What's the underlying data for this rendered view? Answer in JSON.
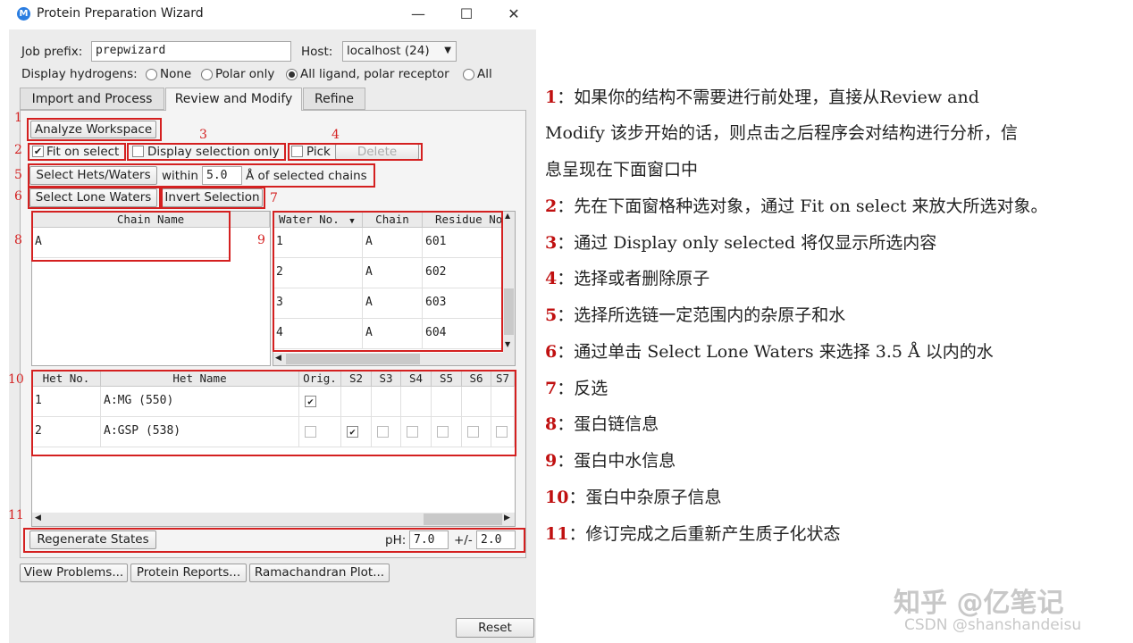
{
  "window": {
    "title": "Protein Preparation Wizard",
    "app_icon_letter": "M",
    "minimize": "—",
    "maximize": "☐",
    "close": "✕"
  },
  "form": {
    "job_prefix_label": "Job prefix:",
    "job_prefix_value": "prepwizard",
    "host_label": "Host:",
    "host_value": "localhost (24)",
    "display_hydrogens_label": "Display hydrogens:",
    "hydrogen_options": [
      "None",
      "Polar only",
      "All ligand, polar receptor",
      "All"
    ],
    "hydrogen_selected": "All ligand, polar receptor"
  },
  "tabs": [
    "Import and Process",
    "Review and Modify",
    "Refine"
  ],
  "active_tab": "Review and Modify",
  "review": {
    "analyze_button": "Analyze Workspace",
    "fit_on_select": "Fit on select",
    "fit_on_select_checked": true,
    "display_selection_only": "Display selection only",
    "pick_label": "Pick",
    "delete_button": "Delete",
    "select_hets_button": "Select Hets/Waters",
    "within_label": "within",
    "within_value": "5.0",
    "of_selected_label": "Å of selected chains",
    "select_lone_waters_button": "Select Lone Waters",
    "invert_selection_button": "Invert Selection",
    "chain_table": {
      "headers": [
        "Chain Name"
      ],
      "rows": [
        [
          "A"
        ]
      ]
    },
    "water_table": {
      "headers": [
        "Water No.",
        "Chain",
        "Residue No."
      ],
      "rows": [
        [
          "1",
          "A",
          "601"
        ],
        [
          "2",
          "A",
          "602"
        ],
        [
          "3",
          "A",
          "603"
        ],
        [
          "4",
          "A",
          "604"
        ]
      ]
    },
    "het_table": {
      "headers": [
        "Het No.",
        "Het Name",
        "Orig.",
        "S2",
        "S3",
        "S4",
        "S5",
        "S6",
        "S7"
      ],
      "rows": [
        {
          "no": "1",
          "name": "A:MG (550)",
          "states": [
            true,
            null,
            null,
            null,
            null,
            null,
            null
          ]
        },
        {
          "no": "2",
          "name": "A:GSP (538)",
          "states": [
            false,
            true,
            false,
            false,
            false,
            false,
            false
          ]
        }
      ]
    },
    "regenerate_button": "Regenerate States",
    "ph_label": "pH:",
    "ph_value": "7.0",
    "pm_label": "+/-",
    "pm_value": "2.0"
  },
  "bottom": {
    "view_problems": "View Problems...",
    "protein_reports": "Protein Reports...",
    "ramachandran": "Ramachandran Plot...",
    "reset": "Reset"
  },
  "markers": [
    "1",
    "2",
    "3",
    "4",
    "5",
    "6",
    "7",
    "8",
    "9",
    "10",
    "11"
  ],
  "annotations": [
    {
      "n": "1",
      "lines": [
        "：如果你的结构不需要进行前处理，直接从Review  and",
        "Modify 该步开始的话，则点击之后程序会对结构进行分析，信",
        "息呈现在下面窗口中"
      ]
    },
    {
      "n": "2",
      "lines": [
        "：先在下面窗格种选对象，通过 Fit on select 来放大所选对象。"
      ]
    },
    {
      "n": "3",
      "lines": [
        "：通过 Display only selected 将仅显示所选内容"
      ]
    },
    {
      "n": "4",
      "lines": [
        "：选择或者删除原子"
      ]
    },
    {
      "n": "5",
      "lines": [
        "：选择所选链一定范围内的杂原子和水"
      ]
    },
    {
      "n": "6",
      "lines": [
        "：通过单击 Select Lone Waters 来选择 3.5 Å 以内的水"
      ]
    },
    {
      "n": "7",
      "lines": [
        "：反选"
      ]
    },
    {
      "n": "8",
      "lines": [
        "：蛋白链信息"
      ]
    },
    {
      "n": "9",
      "lines": [
        "：蛋白中水信息"
      ]
    },
    {
      "n": "10",
      "lines": [
        "：蛋白中杂原子信息"
      ]
    },
    {
      "n": "11",
      "lines": [
        "：修订完成之后重新产生质子化状态"
      ]
    }
  ],
  "watermarks": {
    "zhihu": "知乎 @亿笔记",
    "csdn": "CSDN @shanshandeisu"
  },
  "colors": {
    "accent_red": "#d42020",
    "annotation_number": "#c01010"
  }
}
